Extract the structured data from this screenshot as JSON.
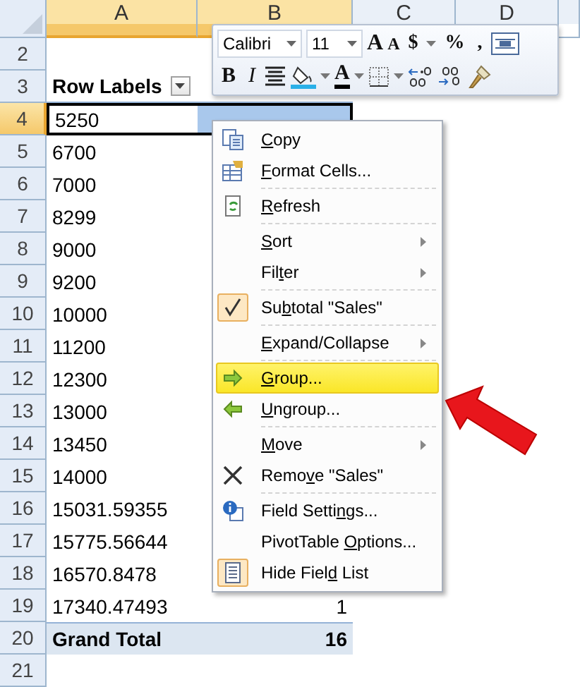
{
  "columns": [
    {
      "label": "A",
      "selected": true
    },
    {
      "label": "B",
      "selected": true
    },
    {
      "label": "C",
      "selected": false
    },
    {
      "label": "D",
      "selected": false
    }
  ],
  "rows": [
    {
      "number": "2",
      "selected": false,
      "kind": "blank"
    },
    {
      "number": "3",
      "selected": false,
      "kind": "header",
      "label": "Row Labels"
    },
    {
      "number": "4",
      "selected": true,
      "kind": "item",
      "label": "5250"
    },
    {
      "number": "5",
      "selected": false,
      "kind": "item",
      "label": "6700"
    },
    {
      "number": "6",
      "selected": false,
      "kind": "item",
      "label": "7000"
    },
    {
      "number": "7",
      "selected": false,
      "kind": "item",
      "label": "8299"
    },
    {
      "number": "8",
      "selected": false,
      "kind": "item",
      "label": "9000"
    },
    {
      "number": "9",
      "selected": false,
      "kind": "item",
      "label": "9200"
    },
    {
      "number": "10",
      "selected": false,
      "kind": "item",
      "label": "10000"
    },
    {
      "number": "11",
      "selected": false,
      "kind": "item",
      "label": "11200"
    },
    {
      "number": "12",
      "selected": false,
      "kind": "item",
      "label": "12300"
    },
    {
      "number": "13",
      "selected": false,
      "kind": "item",
      "label": "13000"
    },
    {
      "number": "14",
      "selected": false,
      "kind": "item",
      "label": "13450"
    },
    {
      "number": "15",
      "selected": false,
      "kind": "item",
      "label": "14000"
    },
    {
      "number": "16",
      "selected": false,
      "kind": "item",
      "label": "15031.59355"
    },
    {
      "number": "17",
      "selected": false,
      "kind": "item",
      "label": "15775.56644"
    },
    {
      "number": "18",
      "selected": false,
      "kind": "item",
      "label": "16570.8478"
    },
    {
      "number": "19",
      "selected": false,
      "kind": "item",
      "label": "17340.47493",
      "value": "1"
    },
    {
      "number": "20",
      "selected": false,
      "kind": "total",
      "label": "Grand Total",
      "value": "16"
    },
    {
      "number": "21",
      "selected": false,
      "kind": "blank"
    }
  ],
  "mini_toolbar": {
    "font": "Calibri",
    "size": "11",
    "row_1": [
      {
        "kind": "grow",
        "text": "A"
      },
      {
        "kind": "shrink",
        "text": "A"
      },
      {
        "kind": "text",
        "text": "$"
      },
      {
        "kind": "caret"
      },
      {
        "kind": "text",
        "text": "%"
      },
      {
        "kind": "text",
        "text": ","
      },
      {
        "kind": "wrap"
      }
    ],
    "row_2": [
      {
        "kind": "bold",
        "text": "B"
      },
      {
        "kind": "italic",
        "text": "I"
      },
      {
        "kind": "center"
      },
      {
        "kind": "fill"
      },
      {
        "kind": "caret"
      },
      {
        "kind": "font_color",
        "text": "A"
      },
      {
        "kind": "caret"
      },
      {
        "kind": "borders"
      },
      {
        "kind": "caret"
      },
      {
        "kind": "inc_decimal"
      },
      {
        "kind": "dec_decimal"
      },
      {
        "kind": "painter"
      }
    ]
  },
  "context_menu": [
    {
      "kind": "item",
      "access_key": "C",
      "after": "opy",
      "submenu": false,
      "highlighted": false,
      "checked": false
    },
    {
      "kind": "item",
      "access_key": "F",
      "after": "ormat Cells...",
      "submenu": false,
      "highlighted": false,
      "checked": false
    },
    {
      "kind": "separator"
    },
    {
      "kind": "item",
      "access_key": "R",
      "after": "efresh",
      "submenu": false,
      "highlighted": false,
      "checked": false
    },
    {
      "kind": "separator"
    },
    {
      "kind": "item",
      "access_key": "S",
      "after": "ort",
      "submenu": true,
      "highlighted": false,
      "checked": false
    },
    {
      "kind": "item",
      "before": "Fil",
      "access_key": "t",
      "after": "er",
      "submenu": true,
      "highlighted": false,
      "checked": false
    },
    {
      "kind": "separator"
    },
    {
      "kind": "item",
      "before": "Su",
      "access_key": "b",
      "after": "total \"Sales\"",
      "submenu": false,
      "highlighted": false,
      "checked": true
    },
    {
      "kind": "separator"
    },
    {
      "kind": "item",
      "access_key": "E",
      "after": "xpand/Collapse",
      "submenu": true,
      "highlighted": false,
      "checked": false
    },
    {
      "kind": "separator"
    },
    {
      "kind": "item",
      "access_key": "G",
      "after": "roup...",
      "submenu": false,
      "highlighted": true,
      "checked": false
    },
    {
      "kind": "item",
      "access_key": "U",
      "after": "ngroup...",
      "submenu": false,
      "highlighted": false,
      "checked": false
    },
    {
      "kind": "separator"
    },
    {
      "kind": "item",
      "access_key": "M",
      "after": "ove",
      "submenu": true,
      "highlighted": false,
      "checked": false
    },
    {
      "kind": "item",
      "before": "Remo",
      "access_key": "v",
      "after": "e \"Sales\"",
      "submenu": false,
      "highlighted": false,
      "checked": false
    },
    {
      "kind": "separator"
    },
    {
      "kind": "item",
      "before": "Field Setti",
      "access_key": "n",
      "after": "gs...",
      "submenu": false,
      "highlighted": false,
      "checked": false
    },
    {
      "kind": "item",
      "before": "PivotTable ",
      "access_key": "O",
      "after": "ptions...",
      "submenu": false,
      "highlighted": false,
      "checked": false
    },
    {
      "kind": "item",
      "before": "Hide Fiel",
      "access_key": "d",
      "after": " List",
      "submenu": false,
      "highlighted": false,
      "checked": true
    }
  ]
}
